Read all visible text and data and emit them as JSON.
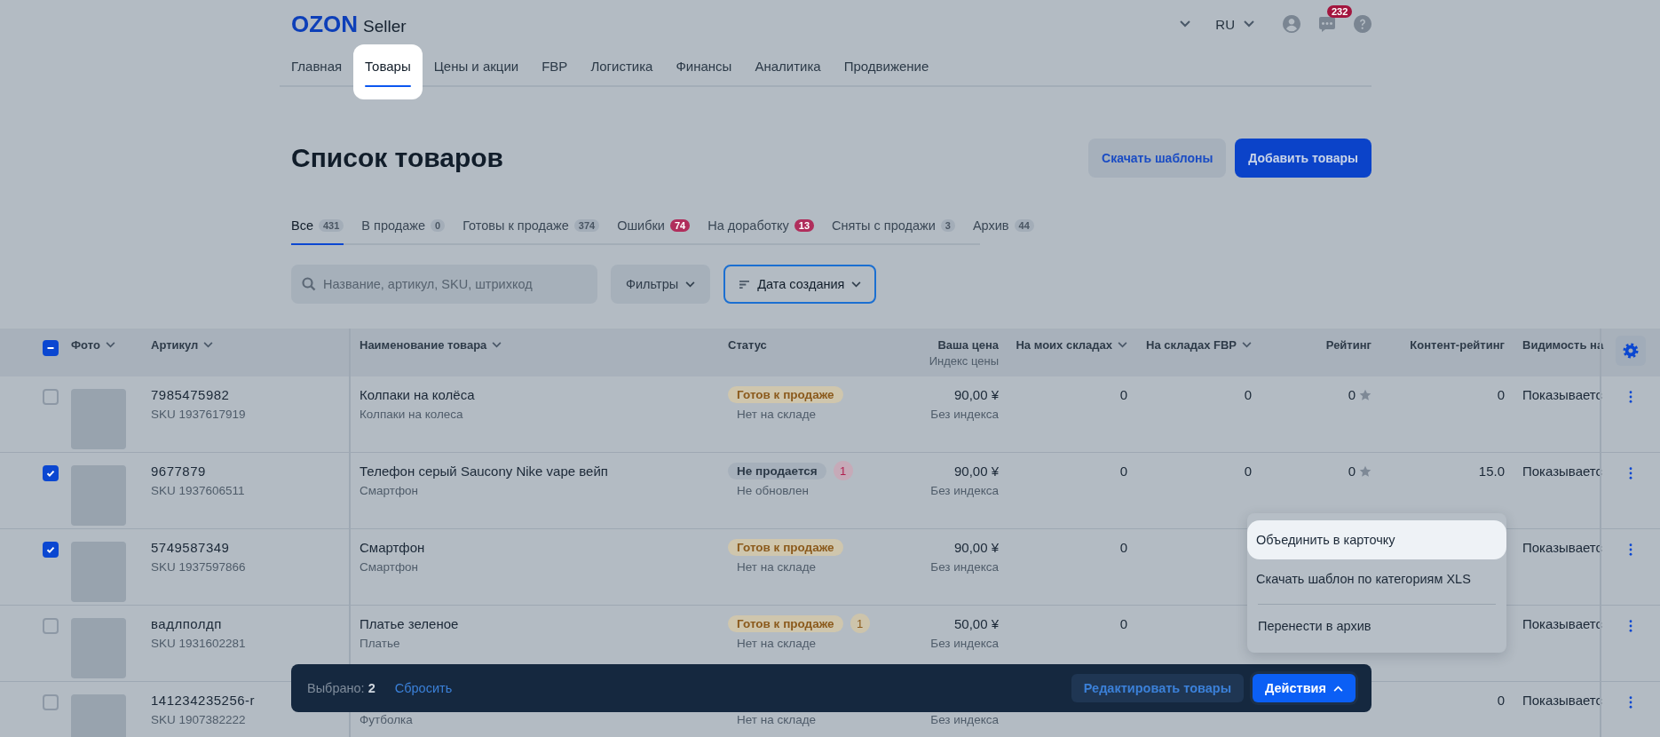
{
  "header": {
    "logo": "OZON",
    "logo_sub": "Seller",
    "language": "RU",
    "notifications": "232"
  },
  "nav": [
    {
      "label": "Главная",
      "selected": false
    },
    {
      "label": "Товары",
      "selected": true
    },
    {
      "label": "Цены и акции",
      "selected": false
    },
    {
      "label": "FBP",
      "selected": false
    },
    {
      "label": "Логистика",
      "selected": false
    },
    {
      "label": "Финансы",
      "selected": false
    },
    {
      "label": "Аналитика",
      "selected": false
    },
    {
      "label": "Продвижение",
      "selected": false
    }
  ],
  "page_title": "Список товаров",
  "page_buttons": [
    {
      "label": "Скачать шаблоны",
      "kind": "secondary"
    },
    {
      "label": "Добавить товары",
      "kind": "primary"
    }
  ],
  "tabs": [
    {
      "label": "Все",
      "count": "431",
      "selected": true,
      "alert": false
    },
    {
      "label": "В продаже",
      "count": "0",
      "selected": false,
      "alert": false
    },
    {
      "label": "Готовы к продаже",
      "count": "374",
      "selected": false,
      "alert": false
    },
    {
      "label": "Ошибки",
      "count": "74",
      "selected": false,
      "alert": true
    },
    {
      "label": "На доработку",
      "count": "13",
      "selected": false,
      "alert": true
    },
    {
      "label": "Сняты с продажи",
      "count": "3",
      "selected": false,
      "alert": false
    },
    {
      "label": "Архив",
      "count": "44",
      "selected": false,
      "alert": false
    }
  ],
  "search": {
    "placeholder": "Название, артикул, SKU, штрихкод"
  },
  "filters": {
    "label": "Фильтры"
  },
  "sort": {
    "label": "Дата создания",
    "focused": true
  },
  "table": {
    "select_all": {
      "indeterminate": true
    },
    "columns": [
      {
        "label": "Фото",
        "sortable": true
      },
      {
        "label": "Артикул",
        "sortable": true
      },
      {
        "label": "Наименование товара",
        "sortable": true
      },
      {
        "label": "Статус",
        "sortable": false
      },
      {
        "label": "Ваша цена",
        "sub": "Индекс цены",
        "sortable": false
      },
      {
        "label": "На моих складах",
        "sortable": true
      },
      {
        "label": "На складах FBP",
        "sortable": true
      },
      {
        "label": "Рейтинг",
        "sortable": false
      },
      {
        "label": "Контент-рейтинг",
        "sortable": false
      },
      {
        "label": "Видимость на",
        "sortable": false
      }
    ],
    "rows": [
      {
        "checked": false,
        "article": "7985475982",
        "sku": "SKU 1937617919",
        "name": "Колпаки на колёса",
        "category": "Колпаки на колеса",
        "status": {
          "label": "Готов к продаже",
          "kind": "ready"
        },
        "status_note": "Нет на складе",
        "price": "90,00 ¥",
        "price_index": "Без индекса",
        "my_stock": "0",
        "fbp_stock": "0",
        "rating": "0",
        "content_rating": "0",
        "visibility": "Показываетс"
      },
      {
        "checked": true,
        "article": "9677879",
        "sku": "SKU 1937606511",
        "name": "Телефон серый Saucony Nike vape вейп",
        "category": "Смартфон",
        "status": {
          "label": "Не продается",
          "kind": "not_selling"
        },
        "issues": {
          "count": "1",
          "kind": "error"
        },
        "status_note": "Не обновлен",
        "price": "90,00 ¥",
        "price_index": "Без индекса",
        "my_stock": "0",
        "fbp_stock": "0",
        "rating": "0",
        "content_rating": "15.0",
        "visibility": "Показываетс"
      },
      {
        "checked": true,
        "article": "5749587349",
        "sku": "SKU 1937597866",
        "name": "Смартфон",
        "category": "Смартфон",
        "status": {
          "label": "Готов к продаже",
          "kind": "ready"
        },
        "status_note": "Нет на складе",
        "price": "90,00 ¥",
        "price_index": "Без индекса",
        "my_stock": "0",
        "visibility": "Показываетс"
      },
      {
        "checked": false,
        "article": "вадлполдп",
        "sku": "SKU 1931602281",
        "name": "Платье зеленое",
        "category": "Платье",
        "status": {
          "label": "Готов к продаже",
          "kind": "ready"
        },
        "issues": {
          "count": "1",
          "kind": "warning"
        },
        "status_note": "Нет на складе",
        "price": "50,00 ¥",
        "price_index": "Без индекса",
        "my_stock": "0",
        "visibility": "Показываетс"
      },
      {
        "checked": false,
        "article": "141234235256-r",
        "sku": "SKU 1907382222",
        "category": "Футболка",
        "status_note": "Нет на складе",
        "price_index": "Без индекса",
        "content_rating": "0",
        "visibility": "Показываетс"
      }
    ]
  },
  "selection_bar": {
    "text": "Выбрано: **2**",
    "reset": "Сбросить",
    "buttons": [
      {
        "label": "Редактировать товары",
        "kind": "secondary",
        "expanded": false
      },
      {
        "label": "Действия",
        "kind": "primary",
        "expanded": true
      }
    ]
  },
  "actions_menu": [
    {
      "label": "Объединить в карточку",
      "selected": true,
      "divider_before": false
    },
    {
      "label": "Скачать шаблон по категориям XLS",
      "selected": false,
      "divider_before": false
    },
    {
      "label": "Перенести в архив",
      "selected": false,
      "divider_before": true
    }
  ]
}
